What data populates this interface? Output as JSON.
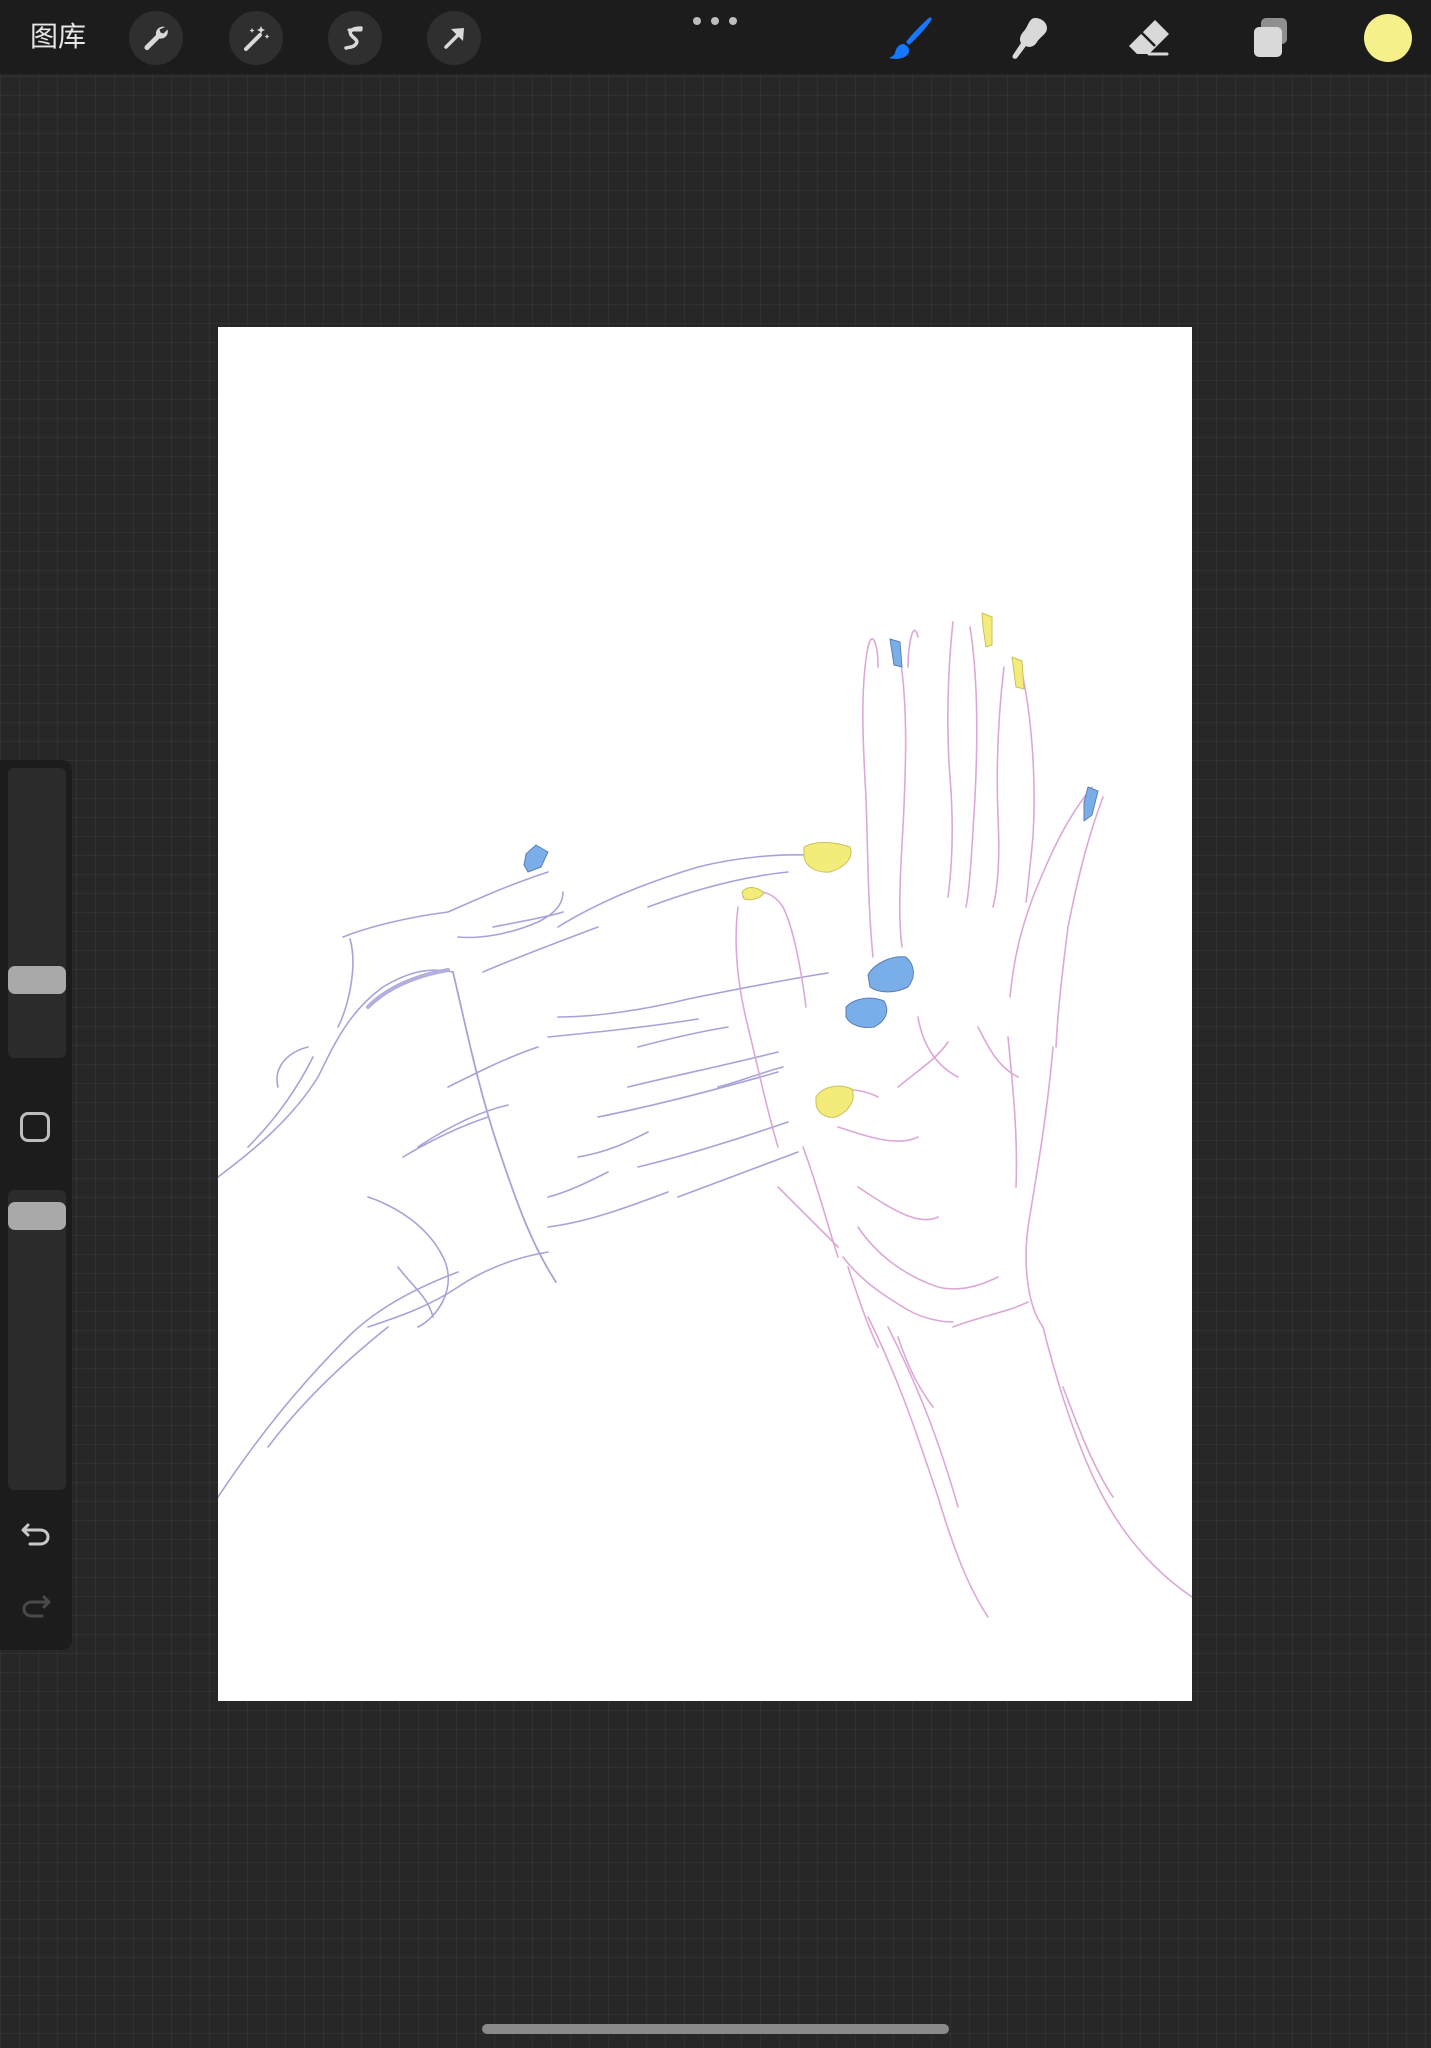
{
  "app": {
    "gallery_label": "图库"
  },
  "toolbar_left": [
    {
      "icon": "wrench-icon",
      "name": "actions"
    },
    {
      "icon": "magic-wand-icon",
      "name": "adjustments"
    },
    {
      "icon": "selection-s-icon",
      "name": "selection"
    },
    {
      "icon": "arrow-cursor-icon",
      "name": "transform"
    }
  ],
  "toolbar_right": [
    {
      "icon": "brush-icon",
      "name": "paint",
      "active": true
    },
    {
      "icon": "smudge-icon",
      "name": "smudge",
      "active": false
    },
    {
      "icon": "eraser-icon",
      "name": "erase",
      "active": false
    },
    {
      "icon": "layers-icon",
      "name": "layers",
      "active": false
    }
  ],
  "colors": {
    "current_color": "#f6f08a",
    "active_tool": "#1677ff",
    "icon_default": "#d9d9d9",
    "sketch_purple": "#a7a3d8",
    "sketch_pink": "#dca8d8",
    "nail_blue": "#7aaee8",
    "nail_yellow": "#f3ec7a"
  },
  "sidebar": {
    "icons": [
      "modify-square-icon",
      "undo-icon",
      "redo-icon"
    ]
  }
}
